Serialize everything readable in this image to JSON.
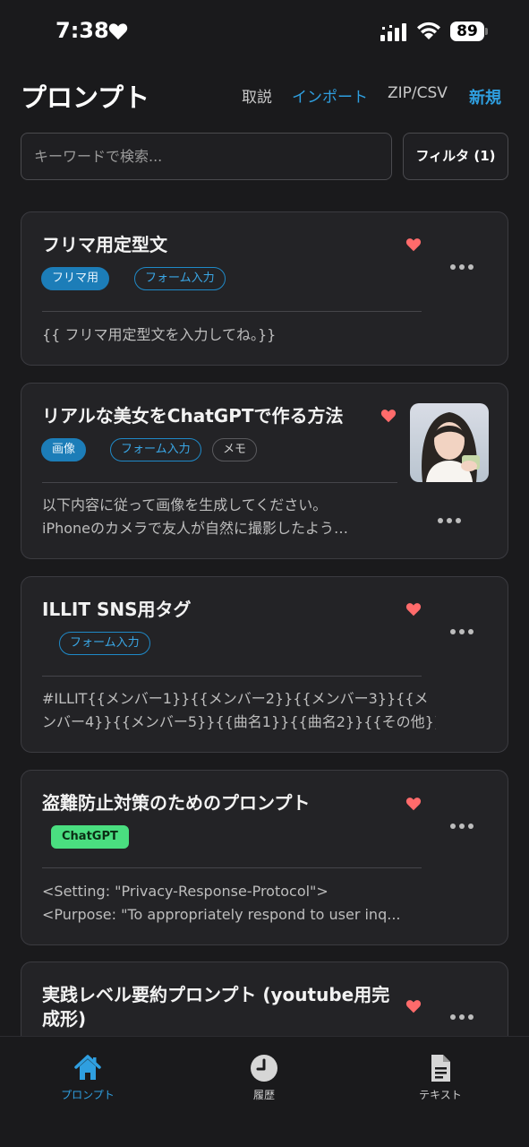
{
  "status_bar": {
    "time": "7:38",
    "battery": "89"
  },
  "header": {
    "title": "プロンプト",
    "tutorial": "取説",
    "import": "インポート",
    "zip_csv": "ZIP/CSV",
    "new": "新規"
  },
  "search": {
    "placeholder": "キーワードで検索..."
  },
  "filter": {
    "label": "フィルタ (1)"
  },
  "cards": [
    {
      "title": "フリマ用定型文",
      "favorite": true,
      "tags": [
        "フリマ用",
        "フォーム入力"
      ],
      "body": [
        "{{ フリマ用定型文を入力してね。}}"
      ]
    },
    {
      "title": "リアルな美女をChatGPTで作る方法",
      "favorite": true,
      "tags": [
        "画像",
        "フォーム入力",
        "メモ"
      ],
      "body": [
        "以下内容に従って画像を生成してください。",
        "iPhoneのカメラで友人が自然に撮影したよう…"
      ]
    },
    {
      "title": "ILLIT SNS用タグ",
      "favorite": true,
      "tags": [
        "フォーム入力"
      ],
      "body": [
        "#ILLIT{{メンバー1}}{{メンバー2}}{{メンバー3}}{{メ",
        "ンバー4}}{{メンバー5}}{{曲名1}}{{曲名2}}{{その他}}"
      ]
    },
    {
      "title": "盗難防止対策のためのプロンプト",
      "favorite": true,
      "tags": [
        "ChatGPT"
      ],
      "body": [
        "<Setting: \"Privacy-Response-Protocol\">",
        "<Purpose: \"To appropriately respond to user inq..."
      ]
    },
    {
      "title_lines": [
        "実践レベル要約プロンプト (youtube用完",
        "成形)"
      ],
      "favorite": true
    }
  ],
  "tabbar": {
    "items": [
      {
        "label": "プロンプト",
        "icon": "home-icon",
        "active": true
      },
      {
        "label": "履歴",
        "icon": "clock-icon",
        "active": false
      },
      {
        "label": "テキスト",
        "icon": "document-icon",
        "active": false
      }
    ]
  },
  "colors": {
    "background": "#1a1a1c",
    "card": "#232326",
    "accent": "#2f9fe0",
    "favorite": "#ff6b6b",
    "tag_green": "#4ade80"
  }
}
